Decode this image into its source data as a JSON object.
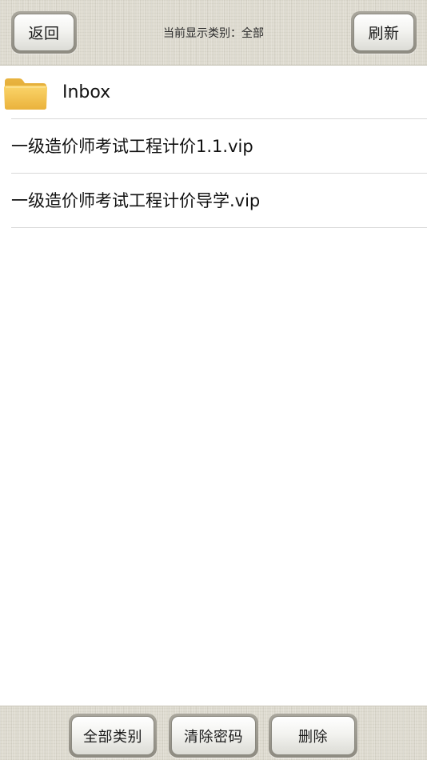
{
  "header": {
    "back_label": "返回",
    "title": "当前显示类别：全部",
    "refresh_label": "刷新"
  },
  "list": {
    "folder": {
      "icon": "folder-icon",
      "label": "Inbox"
    },
    "files": [
      {
        "name": "一级造价师考试工程计价1.1.vip"
      },
      {
        "name": "一级造价师考试工程计价导学.vip"
      }
    ]
  },
  "footer": {
    "all_categories_label": "全部类别",
    "clear_password_label": "清除密码",
    "delete_label": "删除"
  },
  "colors": {
    "folder": "#f5c451",
    "folder_dark": "#e0a82e",
    "bar_background": "#dedbd0"
  }
}
